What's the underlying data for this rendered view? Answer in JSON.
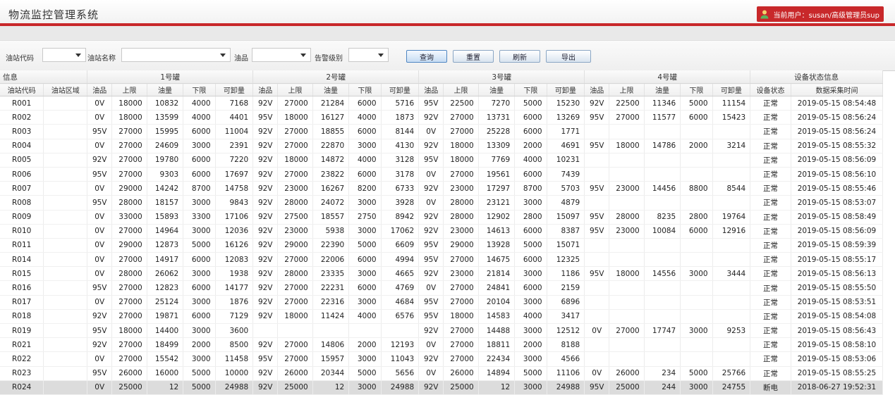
{
  "app": {
    "title": "物流监控管理系统",
    "user_label": "当前用户：susan/高级管理员sup",
    "brand_color": "#c8282a"
  },
  "filters": {
    "station_code_label": "油站代码",
    "station_name_label": "油站名称",
    "oil_label": "油品",
    "alarm_level_label": "告警级别",
    "station_code_value": "",
    "station_name_value": "",
    "oil_value": "",
    "alarm_level_value": ""
  },
  "buttons": {
    "query": "查询",
    "reset": "重置",
    "refresh": "刷新",
    "export": "导出"
  },
  "table": {
    "group_headers": [
      "信息",
      "1号罐",
      "2号罐",
      "3号罐",
      "4号罐",
      "设备状态信息"
    ],
    "columns": [
      "油站代码",
      "油站区域",
      "油品",
      "上限",
      "油量",
      "下限",
      "可卸量",
      "油品",
      "上限",
      "油量",
      "下限",
      "可卸量",
      "油品",
      "上限",
      "油量",
      "下限",
      "可卸量",
      "油品",
      "上限",
      "油量",
      "下限",
      "可卸量",
      "设备状态",
      "数据采集时间"
    ],
    "rows": [
      [
        "R001",
        "",
        "0V",
        "18000",
        "10832",
        "4000",
        "7168",
        "92V",
        "27000",
        "21284",
        "6000",
        "5716",
        "95V",
        "22500",
        "7270",
        "5000",
        "15230",
        "92V",
        "22500",
        "11346",
        "5000",
        "11154",
        "正常",
        "2019-05-15 08:54:48"
      ],
      [
        "R002",
        "",
        "0V",
        "18000",
        "13599",
        "4000",
        "4401",
        "95V",
        "18000",
        "16127",
        "4000",
        "1873",
        "92V",
        "27000",
        "13731",
        "6000",
        "13269",
        "95V",
        "27000",
        "11577",
        "6000",
        "15423",
        "正常",
        "2019-05-15 08:56:24"
      ],
      [
        "R003",
        "",
        "95V",
        "27000",
        "15995",
        "6000",
        "11004",
        "92V",
        "27000",
        "18855",
        "6000",
        "8144",
        "0V",
        "27000",
        "25228",
        "6000",
        "1771",
        "",
        "",
        "",
        "",
        "",
        "正常",
        "2019-05-15 08:56:24"
      ],
      [
        "R004",
        "",
        "0V",
        "27000",
        "24609",
        "3000",
        "2391",
        "92V",
        "27000",
        "22870",
        "3000",
        "4130",
        "92V",
        "18000",
        "13309",
        "2000",
        "4691",
        "95V",
        "18000",
        "14786",
        "2000",
        "3214",
        "正常",
        "2019-05-15 08:55:32"
      ],
      [
        "R005",
        "",
        "92V",
        "27000",
        "19780",
        "6000",
        "7220",
        "92V",
        "18000",
        "14872",
        "4000",
        "3128",
        "95V",
        "18000",
        "7769",
        "4000",
        "10231",
        "",
        "",
        "",
        "",
        "",
        "正常",
        "2019-05-15 08:56:09"
      ],
      [
        "R006",
        "",
        "95V",
        "27000",
        "9303",
        "6000",
        "17697",
        "92V",
        "27000",
        "23822",
        "6000",
        "3178",
        "0V",
        "27000",
        "19561",
        "6000",
        "7439",
        "",
        "",
        "",
        "",
        "",
        "正常",
        "2019-05-15 08:56:10"
      ],
      [
        "R007",
        "",
        "0V",
        "29000",
        "14242",
        "8700",
        "14758",
        "92V",
        "23000",
        "16267",
        "8200",
        "6733",
        "92V",
        "23000",
        "17297",
        "8700",
        "5703",
        "95V",
        "23000",
        "14456",
        "8800",
        "8544",
        "正常",
        "2019-05-15 08:55:46"
      ],
      [
        "R008",
        "",
        "95V",
        "28000",
        "18157",
        "3000",
        "9843",
        "92V",
        "28000",
        "24072",
        "3000",
        "3928",
        "0V",
        "28000",
        "23121",
        "3000",
        "4879",
        "",
        "",
        "",
        "",
        "",
        "正常",
        "2019-05-15 08:53:07"
      ],
      [
        "R009",
        "",
        "0V",
        "33000",
        "15893",
        "3300",
        "17106",
        "92V",
        "27500",
        "18557",
        "2750",
        "8942",
        "92V",
        "28000",
        "12902",
        "2800",
        "15097",
        "95V",
        "28000",
        "8235",
        "2800",
        "19764",
        "正常",
        "2019-05-15 08:58:49"
      ],
      [
        "R010",
        "",
        "0V",
        "27000",
        "14964",
        "3000",
        "12036",
        "92V",
        "23000",
        "5938",
        "3000",
        "17062",
        "92V",
        "23000",
        "14613",
        "6000",
        "8387",
        "95V",
        "23000",
        "10084",
        "6000",
        "12916",
        "正常",
        "2019-05-15 08:56:09"
      ],
      [
        "R011",
        "",
        "0V",
        "29000",
        "12873",
        "5000",
        "16126",
        "92V",
        "29000",
        "22390",
        "5000",
        "6609",
        "95V",
        "29000",
        "13928",
        "5000",
        "15071",
        "",
        "",
        "",
        "",
        "",
        "正常",
        "2019-05-15 08:59:39"
      ],
      [
        "R014",
        "",
        "0V",
        "27000",
        "14917",
        "6000",
        "12083",
        "92V",
        "27000",
        "22006",
        "6000",
        "4994",
        "95V",
        "27000",
        "14675",
        "6000",
        "12325",
        "",
        "",
        "",
        "",
        "",
        "正常",
        "2019-05-15 08:55:17"
      ],
      [
        "R015",
        "",
        "0V",
        "28000",
        "26062",
        "3000",
        "1938",
        "92V",
        "28000",
        "23335",
        "3000",
        "4665",
        "92V",
        "23000",
        "21814",
        "3000",
        "1186",
        "95V",
        "18000",
        "14556",
        "3000",
        "3444",
        "正常",
        "2019-05-15 08:56:13"
      ],
      [
        "R016",
        "",
        "95V",
        "27000",
        "12823",
        "6000",
        "14177",
        "92V",
        "27000",
        "22231",
        "6000",
        "4769",
        "0V",
        "27000",
        "24841",
        "6000",
        "2159",
        "",
        "",
        "",
        "",
        "",
        "正常",
        "2019-05-15 08:55:50"
      ],
      [
        "R017",
        "",
        "0V",
        "27000",
        "25124",
        "3000",
        "1876",
        "92V",
        "27000",
        "22316",
        "3000",
        "4684",
        "95V",
        "27000",
        "20104",
        "3000",
        "6896",
        "",
        "",
        "",
        "",
        "",
        "正常",
        "2019-05-15 08:53:51"
      ],
      [
        "R018",
        "",
        "92V",
        "27000",
        "19871",
        "6000",
        "7129",
        "92V",
        "18000",
        "11424",
        "4000",
        "6576",
        "95V",
        "18000",
        "14583",
        "4000",
        "3417",
        "",
        "",
        "",
        "",
        "",
        "正常",
        "2019-05-15 08:54:08"
      ],
      [
        "R019",
        "",
        "95V",
        "18000",
        "14400",
        "3000",
        "3600",
        "",
        "",
        "",
        "",
        "",
        "92V",
        "27000",
        "14488",
        "3000",
        "12512",
        "0V",
        "27000",
        "17747",
        "3000",
        "9253",
        "正常",
        "2019-05-15 08:56:43"
      ],
      [
        "R021",
        "",
        "92V",
        "27000",
        "18499",
        "2000",
        "8500",
        "92V",
        "27000",
        "14806",
        "2000",
        "12193",
        "0V",
        "27000",
        "18811",
        "2000",
        "8188",
        "",
        "",
        "",
        "",
        "",
        "正常",
        "2019-05-15 08:58:10"
      ],
      [
        "R022",
        "",
        "0V",
        "27000",
        "15542",
        "3000",
        "11458",
        "95V",
        "27000",
        "15957",
        "3000",
        "11043",
        "92V",
        "27000",
        "22434",
        "3000",
        "4566",
        "",
        "",
        "",
        "",
        "",
        "正常",
        "2019-05-15 08:53:06"
      ],
      [
        "R023",
        "",
        "95V",
        "26000",
        "16000",
        "5000",
        "10000",
        "92V",
        "26000",
        "20344",
        "5000",
        "5656",
        "0V",
        "26000",
        "14894",
        "5000",
        "11106",
        "0V",
        "26000",
        "234",
        "5000",
        "25766",
        "正常",
        "2019-05-15 08:55:25"
      ],
      [
        "R024",
        "",
        "0V",
        "25000",
        "12",
        "5000",
        "24988",
        "92V",
        "25000",
        "12",
        "3000",
        "24988",
        "92V",
        "25000",
        "12",
        "3000",
        "24988",
        "95V",
        "25000",
        "244",
        "3000",
        "24755",
        "断电",
        "2018-06-27 19:52:31"
      ]
    ],
    "selected_row": 20
  }
}
